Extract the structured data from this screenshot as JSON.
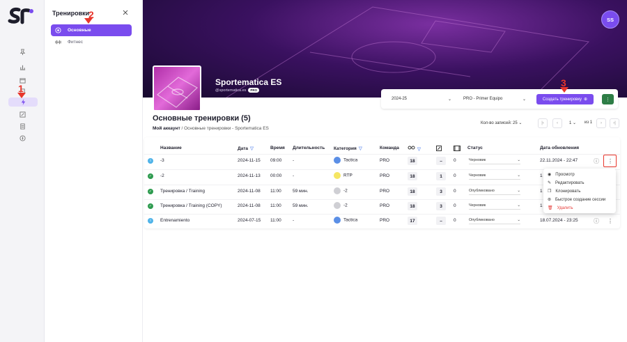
{
  "app": {
    "logo_text": "ST",
    "user_initials": "SS"
  },
  "panel": {
    "title": "Тренировки",
    "items": [
      {
        "label": "Основные",
        "active": true
      },
      {
        "label": "Фитнес",
        "active": false
      }
    ]
  },
  "team": {
    "name": "Sportematica ES",
    "handle": "@sportematica.es",
    "badge": "PRO"
  },
  "filters": {
    "season": "2024-25",
    "team": "PRO - Primer Equipo",
    "create_label": "Создать тренировку",
    "more_label": "⋮"
  },
  "page": {
    "title": "Основные тренировки (5)",
    "breadcrumb_root": "Мой аккаунт",
    "breadcrumb_sep": "/",
    "breadcrumb_current": "Основные тренировки - Sportematica ES"
  },
  "pagination": {
    "per_page_label": "Кол-во записей: 25",
    "current_page": "1",
    "of_label": "из 1"
  },
  "table": {
    "headers": {
      "name": "Название",
      "date": "Дата",
      "time": "Время",
      "duration": "Длительность",
      "category": "Категория",
      "team": "Команда",
      "status": "Статус",
      "updated": "Дата обновления"
    },
    "rows": [
      {
        "state": "info",
        "name": "-3",
        "date": "2024-11-15",
        "time": "09:00",
        "duration": "-",
        "cat_color": "#5b8fe6",
        "category": "Tactica",
        "team": "PRO",
        "players": "18",
        "exercises": "–",
        "videos": "0",
        "status": "Черновик",
        "updated": "22.11.2024 - 22:47"
      },
      {
        "state": "done",
        "name": "-2",
        "date": "2024-11-13",
        "time": "00:00",
        "duration": "-",
        "cat_color": "#f5e663",
        "category": "RTP",
        "team": "PRO",
        "players": "18",
        "exercises": "1",
        "videos": "0",
        "status": "Черновик",
        "updated": "1"
      },
      {
        "state": "done",
        "name": "Тренировка / Training",
        "date": "2024-11-08",
        "time": "11:00",
        "duration": "59 мин.",
        "cat_color": "#cfcfd4",
        "category": "-2",
        "team": "PRO",
        "players": "18",
        "exercises": "3",
        "videos": "0",
        "status": "Опубликовано",
        "updated": "1"
      },
      {
        "state": "done",
        "name": "Тренировка / Training (COPY)",
        "date": "2024-11-08",
        "time": "11:00",
        "duration": "59 мин.",
        "cat_color": "#cfcfd4",
        "category": "-2",
        "team": "PRO",
        "players": "18",
        "exercises": "3",
        "videos": "0",
        "status": "Черновик",
        "updated": "1"
      },
      {
        "state": "info",
        "name": "Entrenamiento",
        "date": "2024-07-15",
        "time": "11:00",
        "duration": "-",
        "cat_color": "#5b8fe6",
        "category": "Tactica",
        "team": "PRO",
        "players": "17",
        "exercises": "–",
        "videos": "0",
        "status": "Опубликовано",
        "updated": "18.07.2024 - 23:25"
      }
    ]
  },
  "row_menu": {
    "items": [
      "Просмотр",
      "Редактировать",
      "Клонировать",
      "Быстрое создание сессии",
      "Удалить"
    ]
  },
  "annotations": [
    "1",
    "2",
    "3"
  ],
  "colors": {
    "accent": "#7a4cee",
    "success": "#2e9b4f",
    "info": "#4fb3e8",
    "danger": "#e53935",
    "annotation": "#e8362c"
  }
}
